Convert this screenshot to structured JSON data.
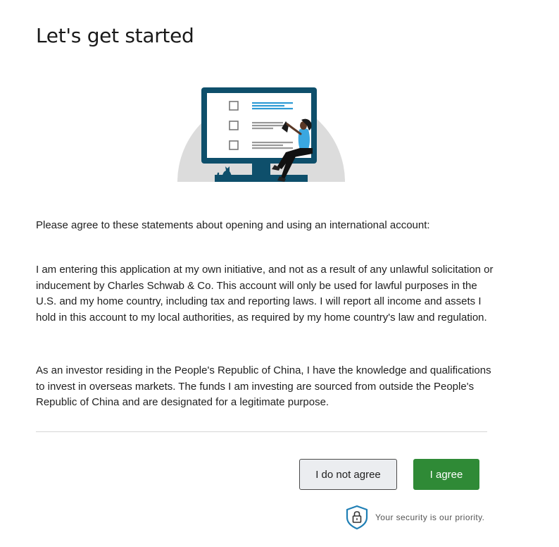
{
  "page": {
    "title": "Let's get started",
    "intro": "Please agree to these statements about opening and using an international account:",
    "statements": [
      "I am entering this application at my own initiative, and not as a result of any unlawful solicitation or inducement by Charles Schwab & Co. This account will only be used for lawful purposes in the U.S. and my home country, including tax and reporting laws. I will report all income and assets I hold in this account to my local authorities, as required by my home country's law and regulation.",
      "As an investor residing in the People's Republic of China, I have the knowledge and qualifications to invest in overseas markets. The funds I am investing are sourced from outside the People's Republic of China and are designated for a legitimate purpose."
    ]
  },
  "actions": {
    "disagree_label": "I do not agree",
    "agree_label": "I agree"
  },
  "security": {
    "text": "Your security is our priority.",
    "icon": "shield-lock-icon"
  },
  "colors": {
    "agree_button": "#2f8a36",
    "disagree_button_bg": "#ebedf0",
    "monitor_frame": "#0e4f6b",
    "accent_blue": "#2f9bd5",
    "security_icon": "#1f7fb5"
  }
}
